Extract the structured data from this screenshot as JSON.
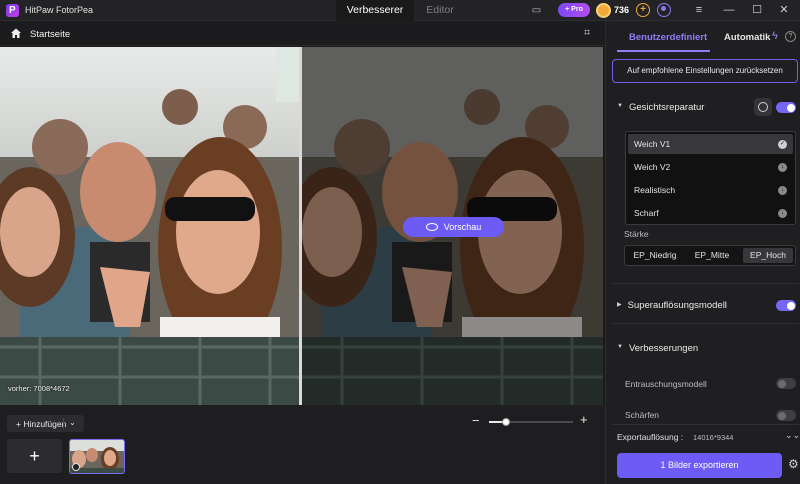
{
  "app": {
    "title": "HitPaw FotorPea",
    "tabs": [
      {
        "label": "Verbesserer",
        "active": true
      },
      {
        "label": "Editor",
        "active": false
      }
    ],
    "pro_label": "+ Pro",
    "coins": "736",
    "accent": "#6c5cf5"
  },
  "breadcrumb": {
    "label": "Startseite"
  },
  "canvas": {
    "preview_label": "Vorschau",
    "before_label": "vorher: 7008*4672"
  },
  "bottom": {
    "add_label": "+ Hinzufügen",
    "new_tile": "+",
    "zoom_minus": "−",
    "zoom_plus": "+",
    "zoom_level": 0.2
  },
  "panel": {
    "tabs": [
      {
        "label": "Benutzerdefiniert",
        "active": true
      },
      {
        "label": "Automatik",
        "active": false
      }
    ],
    "reset_label": "Auf empfohlene Einstellungen zurücksetzen",
    "face_repair": {
      "title": "Gesichtsreparatur",
      "enabled": true,
      "models": [
        {
          "label": "Weich V1",
          "selected": true
        },
        {
          "label": "Weich V2",
          "selected": false
        },
        {
          "label": "Realistisch",
          "selected": false
        },
        {
          "label": "Scharf",
          "selected": false
        }
      ],
      "strength_label": "Stärke",
      "strength_options": [
        "EP_Niedrig",
        "EP_Mitte",
        "EP_Hoch"
      ],
      "strength_selected": "EP_Hoch"
    },
    "superres": {
      "title": "Superauflösungsmodell",
      "enabled": true
    },
    "improvements": {
      "title": "Verbesserungen",
      "items": [
        {
          "label": "Entrauschungsmodell",
          "enabled": false
        },
        {
          "label": "Schärfen",
          "enabled": false
        }
      ]
    },
    "export": {
      "resolution_label": "Exportauflösung :",
      "resolution_value": "14016*9344",
      "button_label": "1 Bilder exportieren"
    }
  }
}
